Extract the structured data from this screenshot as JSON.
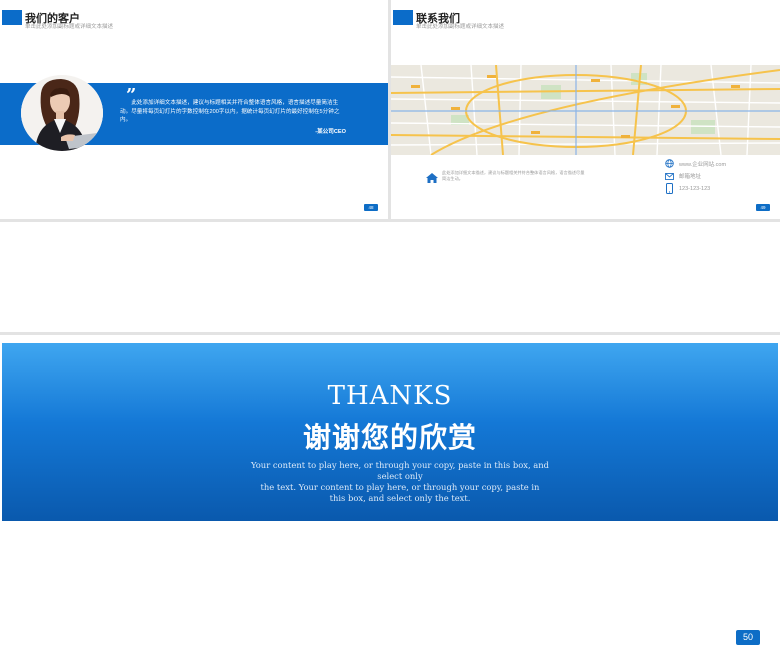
{
  "colors": {
    "brand_blue": "#0b6cc9",
    "page_badge": "#0d6dc6"
  },
  "clients_slide": {
    "title": "我们的客户",
    "subtitle": "单击此处添加副标题或详细文本描述",
    "quote_mark": "”",
    "quote_text": "此处添加详细文本描述，建议与标题相关并符合整体语言风格，语言描述尽量简洁生动。尽量将每页幻灯片的字数控制在200字以内，据统计每页幻灯片的最好控制在5分钟之内。",
    "quote_author": "-某公司CEO",
    "page_badge": "48",
    "avatar_icon": "person-photo-icon"
  },
  "contact_slide": {
    "title": "联系我们",
    "subtitle": "单击此处添加副标题或详细文本描述",
    "address_text": "此处添加详细文本描述，建议与标题相关并符合整体语言风格，语言描述尽量简洁生动。",
    "website": "www.企业网站.com",
    "email": "邮箱地址",
    "phone": "123-123-123",
    "page_badge": "49",
    "icons": [
      "home-icon",
      "globe-icon",
      "mail-icon",
      "phone-icon"
    ]
  },
  "thanks_slide": {
    "title_en": "THANKS",
    "title_cn": "谢谢您的欣赏",
    "body_line1": "Your content to play here, or through your copy, paste in this box, and select only",
    "body_line2": "the text. Your content to play here, or through your copy, paste in",
    "body_line3": "this box, and select only the text.",
    "page_number": "50"
  }
}
